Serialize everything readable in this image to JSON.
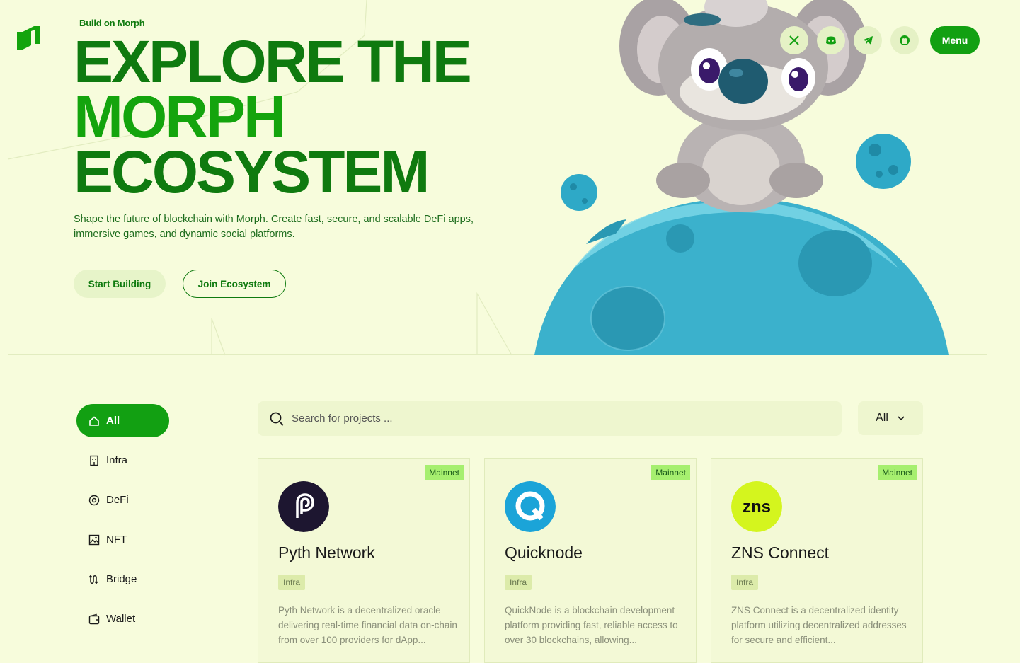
{
  "nav": {
    "menu_label": "Menu",
    "social": [
      {
        "name": "x-icon"
      },
      {
        "name": "discord-icon"
      },
      {
        "name": "telegram-icon"
      },
      {
        "name": "github-icon"
      }
    ]
  },
  "hero": {
    "eyebrow": "Build on Morph",
    "headline_line1": "EXPLORE THE",
    "headline_line2": "MORPH",
    "headline_line3": "ECOSYSTEM",
    "subtitle": "Shape the future of blockchain with Morph. Create fast, secure, and scalable DeFi apps, immersive games, and dynamic social platforms.",
    "primary_cta": "Start Building",
    "secondary_cta": "Join Ecosystem"
  },
  "categories": [
    {
      "label": "All",
      "icon": "home-icon",
      "active": true
    },
    {
      "label": "Infra",
      "icon": "building-icon"
    },
    {
      "label": "DeFi",
      "icon": "coin-icon"
    },
    {
      "label": "NFT",
      "icon": "image-icon"
    },
    {
      "label": "Bridge",
      "icon": "bridge-icon"
    },
    {
      "label": "Wallet",
      "icon": "wallet-icon"
    }
  ],
  "search": {
    "placeholder": "Search for projects ..."
  },
  "filter": {
    "selected": "All"
  },
  "projects": [
    {
      "name": "Pyth Network",
      "network": "Mainnet",
      "tag": "Infra",
      "description": "Pyth Network is a decentralized oracle delivering real-time financial data on-chain from over 100 providers for dApp...",
      "logo": "pyth-logo"
    },
    {
      "name": "Quicknode",
      "network": "Mainnet",
      "tag": "Infra",
      "description": "QuickNode is a blockchain development platform providing fast, reliable access to over 30 blockchains, allowing...",
      "logo": "quicknode-logo"
    },
    {
      "name": "ZNS Connect",
      "network": "Mainnet",
      "tag": "Infra",
      "description": "ZNS Connect is a decentralized identity platform utilizing decentralized addresses for secure and efficient...",
      "logo": "zns-logo",
      "logo_text": "zns"
    }
  ],
  "colors": {
    "background": "#f7fcdc",
    "brand_green": "#12a012",
    "dark_green": "#0f7a0f",
    "badge_green": "#a6ef6f"
  }
}
